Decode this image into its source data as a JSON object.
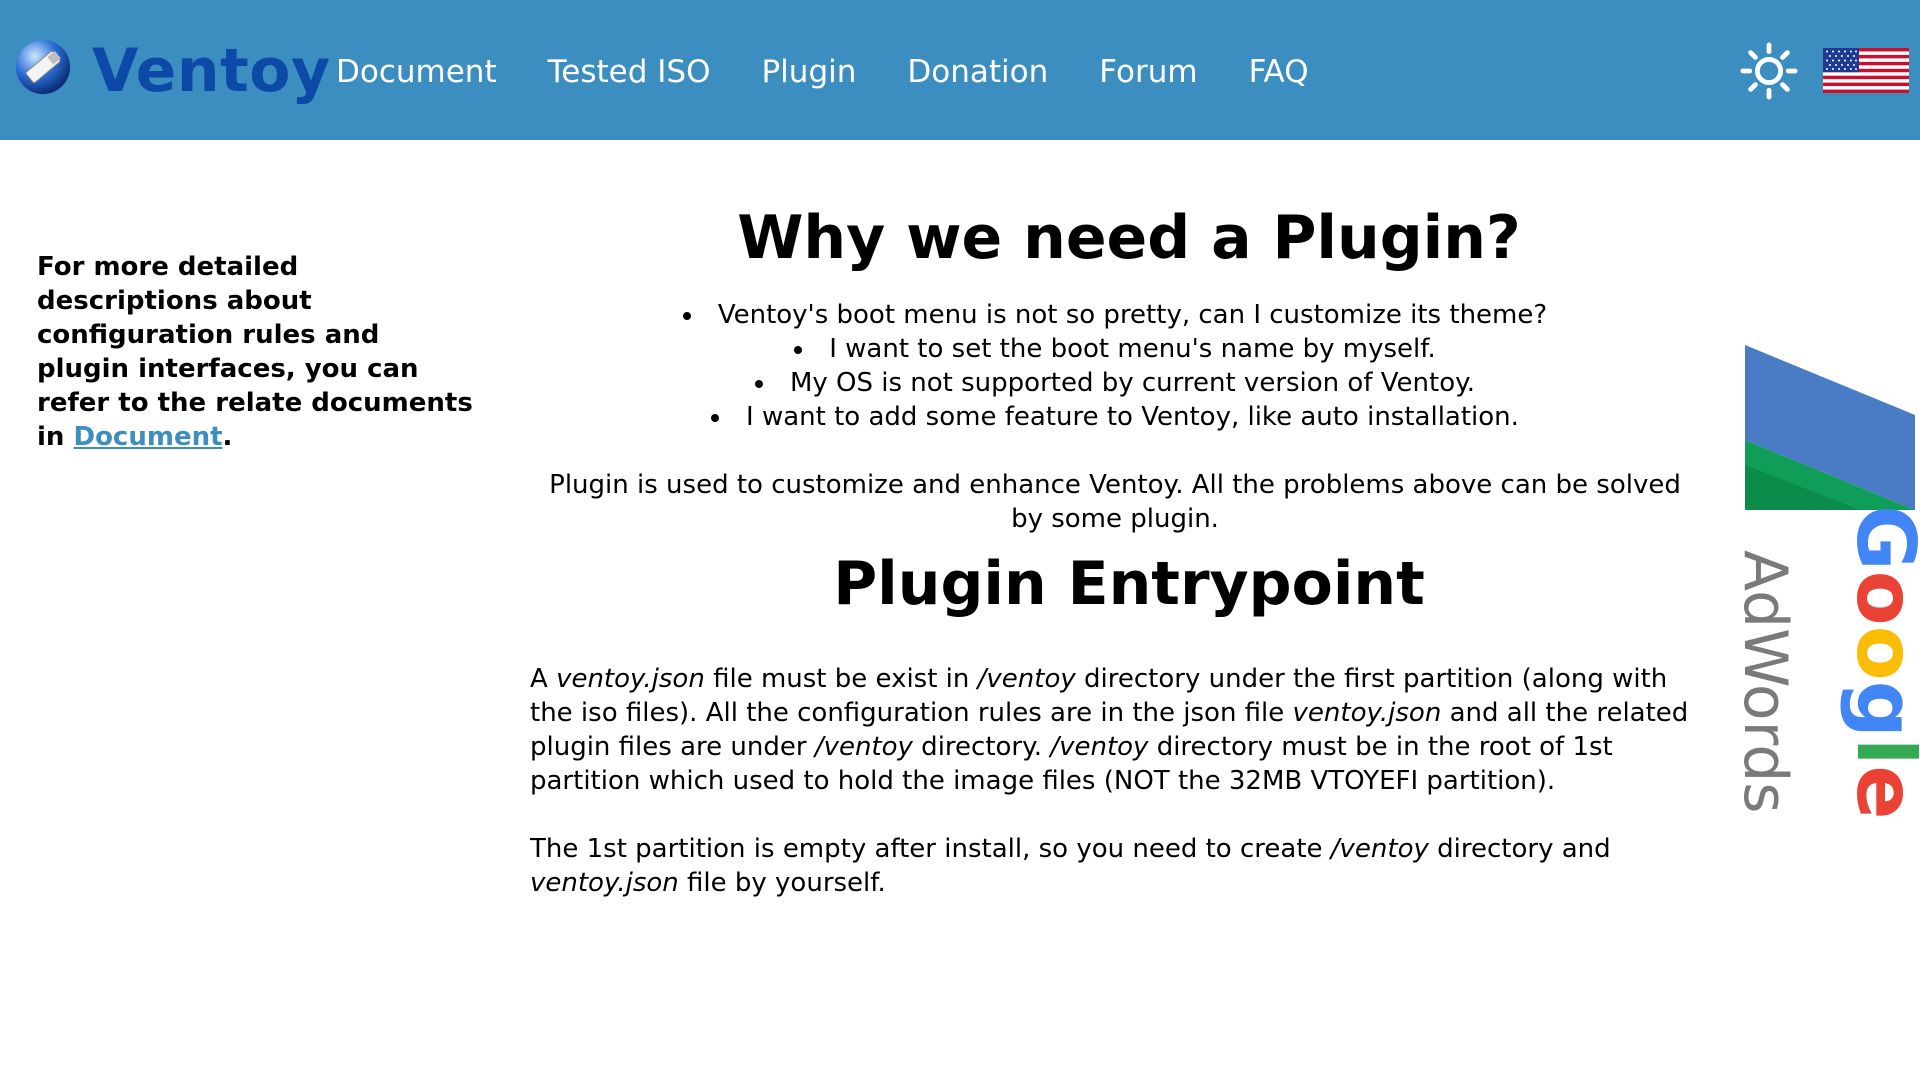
{
  "header": {
    "brand": "Ventoy",
    "nav": [
      {
        "label": "Document"
      },
      {
        "label": "Tested ISO"
      },
      {
        "label": "Plugin"
      },
      {
        "label": "Donation"
      },
      {
        "label": "Forum"
      },
      {
        "label": "FAQ"
      }
    ],
    "icons": {
      "logo": "ventoy-usb-logo",
      "theme": "sun-icon",
      "language": "us-flag-icon"
    }
  },
  "sidebar": {
    "text": "For more detailed descriptions about configuration rules and plugin interfaces, you can refer to the relate documents in ",
    "link": "Document",
    "suffix": "."
  },
  "main": {
    "title1": "Why we need a Plugin?",
    "bullets": [
      "Ventoy's boot menu is not so pretty, can I customize its theme?",
      "I want to set the boot menu's name by myself.",
      "My OS is not supported by current version of Ventoy.",
      "I want to add some feature to Ventoy, like auto installation."
    ],
    "summary": "Plugin is used to customize and enhance Ventoy. All the problems above can be solved by some plugin.",
    "title2": "Plugin Entrypoint",
    "entry1": {
      "t1": "A ",
      "e1": "ventoy.json",
      "t2": " file must be exist in ",
      "e2": "/ventoy",
      "t3": " directory under the first partition (along with the iso files). All the configuration rules are in the json file ",
      "e3": "ventoy.json",
      "t4": " and all the related plugin files are under ",
      "e4": "/ventoy",
      "t5": " directory. ",
      "e5": "/ventoy",
      "t6": " directory must be in the root of 1st partition which used to hold the image files (NOT the 32MB VTOYEFI partition)."
    },
    "entry2": {
      "t1": "The 1st partition is empty after install, so you need to create ",
      "e1": "/ventoy",
      "t2": " directory and ",
      "e2": "ventoy.json",
      "t3": " file by yourself."
    }
  },
  "ad": {
    "google": "Google",
    "adwords": "AdWords",
    "colors": {
      "blue": "#4285f4",
      "red": "#ea4335",
      "yellow": "#fbbc05",
      "green": "#34a853",
      "grey": "#7a7a7a"
    }
  }
}
